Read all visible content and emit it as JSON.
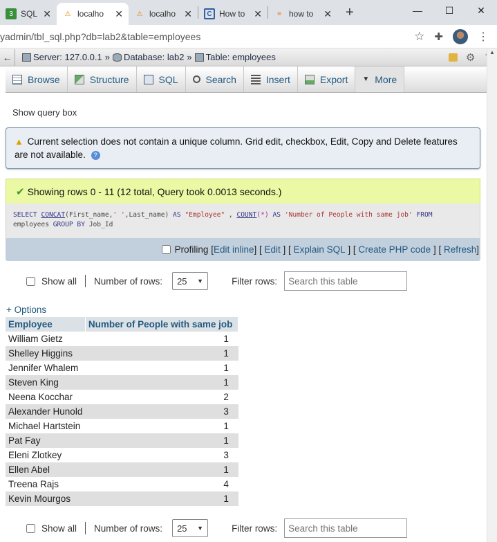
{
  "browser": {
    "tabs": [
      {
        "label": "SQL Ali",
        "icon": "sql-tab-icon",
        "active": false
      },
      {
        "label": "localho",
        "icon": "phpmyadmin-icon",
        "active": true
      },
      {
        "label": "localho",
        "icon": "phpmyadmin-icon",
        "active": false
      },
      {
        "label": "How to",
        "icon": "site-icon",
        "active": false
      },
      {
        "label": "how to",
        "icon": "stackoverflow-icon",
        "active": false
      }
    ],
    "url": "yadmin/tbl_sql.php?db=lab2&table=employees"
  },
  "breadcrumb": {
    "server": "Server: 127.0.0.1",
    "database": "Database: lab2",
    "table": "Table: employees",
    "separator": "»"
  },
  "menu": [
    {
      "label": "Browse",
      "icon": "browse-icon"
    },
    {
      "label": "Structure",
      "icon": "structure-icon"
    },
    {
      "label": "SQL",
      "icon": "sql-icon"
    },
    {
      "label": "Search",
      "icon": "search-icon"
    },
    {
      "label": "Insert",
      "icon": "insert-icon"
    },
    {
      "label": "Export",
      "icon": "export-icon"
    },
    {
      "label": "More",
      "icon": "chevron-down-icon"
    }
  ],
  "show_query_box": "Show query box",
  "notice": {
    "text": "Current selection does not contain a unique column. Grid edit, checkbox, Edit, Copy and Delete features are not available."
  },
  "success": {
    "text": "Showing rows 0 - 11 (12 total, Query took 0.0013 seconds.)"
  },
  "sql": {
    "line1_parts": [
      "SELECT",
      " ",
      "CONCAT",
      "(First_name,",
      "' '",
      ",Last_name) ",
      "AS",
      " ",
      "\"Employee\"",
      " , ",
      "COUNT",
      "(",
      "*",
      ") ",
      "AS",
      " ",
      "'Number of People with same job'",
      " ",
      "FROM"
    ],
    "line2_parts": [
      "employees",
      " ",
      "GROUP BY",
      " Job_Id"
    ]
  },
  "profiling": {
    "label": "Profiling",
    "links": [
      "Edit inline",
      "Edit",
      "Explain SQL",
      "Create PHP code",
      "Refresh"
    ]
  },
  "nav": {
    "show_all": "Show all",
    "rows_label": "Number of rows:",
    "rows_value": "25",
    "filter_label": "Filter rows:",
    "filter_placeholder": "Search this table"
  },
  "options_link": "+ Options",
  "table": {
    "headers": [
      "Employee",
      "Number of People with same job"
    ],
    "rows": [
      [
        "William Gietz",
        "1"
      ],
      [
        "Shelley Higgins",
        "1"
      ],
      [
        "Jennifer Whalem",
        "1"
      ],
      [
        "Steven King",
        "1"
      ],
      [
        "Neena Kocchar",
        "2"
      ],
      [
        "Alexander Hunold",
        "3"
      ],
      [
        "Michael Hartstein",
        "1"
      ],
      [
        "Pat Fay",
        "1"
      ],
      [
        "Eleni Zlotkey",
        "3"
      ],
      [
        "Ellen Abel",
        "1"
      ],
      [
        "Treena Rajs",
        "4"
      ],
      [
        "Kevin Mourgos",
        "1"
      ]
    ]
  }
}
